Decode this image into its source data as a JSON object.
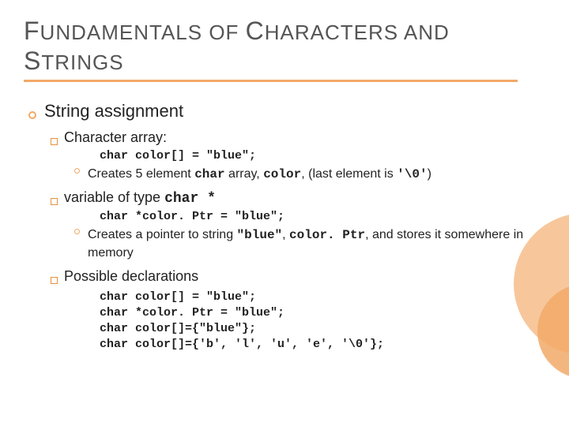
{
  "title": {
    "w1a": "F",
    "w1b": "UNDAMENTALS OF ",
    "w2a": "C",
    "w2b": "HARACTERS AND ",
    "w3a": "S",
    "w3b": "TRINGS"
  },
  "s1": "String assignment",
  "s1a": "Character array:",
  "s1a_code": "char color[] = \"blue\";",
  "s1a_expl_pre": "Creates 5 element ",
  "s1a_expl_m1": "char",
  "s1a_expl_mid": " array, ",
  "s1a_expl_m2": "color",
  "s1a_expl_mid2": ", (last element is ",
  "s1a_expl_m3": "'\\0'",
  "s1a_expl_post": ")",
  "s1b_pre": "variable of type ",
  "s1b_m": "char *",
  "s1b_code": "char *color. Ptr = \"blue\";",
  "s1b_expl_pre": "Creates a pointer to string ",
  "s1b_expl_m1": "\"blue\"",
  "s1b_expl_mid": ", ",
  "s1b_expl_m2": "color. Ptr",
  "s1b_expl_post": ", and stores it somewhere in memory",
  "s1c": "Possible declarations",
  "decl1": "char color[] = \"blue\";",
  "decl2": "char *color. Ptr = \"blue\";",
  "decl3": "char color[]={\"blue\"};",
  "decl4": "char color[]={'b', 'l', 'u', 'e', '\\0'};"
}
